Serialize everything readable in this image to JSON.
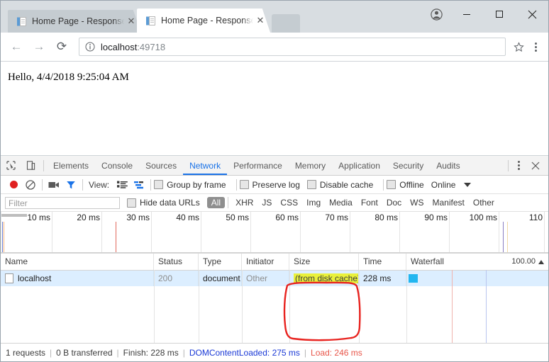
{
  "window": {
    "controls": {
      "avatar": "profile-avatar",
      "minimize": "–",
      "maximize": "☐",
      "close": "✕"
    }
  },
  "tabs": [
    {
      "title": "Home Page - ResponseC",
      "close": "✕",
      "active": false
    },
    {
      "title": "Home Page - ResponseC",
      "close": "✕",
      "active": true
    }
  ],
  "toolbar": {
    "back": "←",
    "forward": "→",
    "reload": "⟳",
    "url_host": "localhost",
    "url_port": ":49718",
    "bookmark": "☆"
  },
  "page": {
    "text": "Hello, 4/4/2018 9:25:04 AM"
  },
  "devtools": {
    "panels": [
      {
        "label": "Elements",
        "active": false
      },
      {
        "label": "Console",
        "active": false
      },
      {
        "label": "Sources",
        "active": false
      },
      {
        "label": "Network",
        "active": true
      },
      {
        "label": "Performance",
        "active": false
      },
      {
        "label": "Memory",
        "active": false
      },
      {
        "label": "Application",
        "active": false
      },
      {
        "label": "Security",
        "active": false
      },
      {
        "label": "Audits",
        "active": false
      }
    ],
    "close": "✕",
    "network_toolbar": {
      "record_title": "record",
      "clear_title": "clear",
      "capture_screenshots_title": "camera",
      "filter_title": "filter",
      "view_label": "View:",
      "checkboxes": [
        {
          "label": "Group by frame",
          "checked": false
        },
        {
          "label": "Preserve log",
          "checked": false
        },
        {
          "label": "Disable cache",
          "checked": false
        },
        {
          "label": "Offline",
          "checked": false
        }
      ],
      "throttling": "Online"
    },
    "filter_bar": {
      "placeholder": "Filter",
      "value": "",
      "hide_data_urls": "Hide data URLs",
      "types": [
        {
          "label": "All",
          "active": true
        },
        {
          "label": "XHR",
          "active": false
        },
        {
          "label": "JS",
          "active": false
        },
        {
          "label": "CSS",
          "active": false
        },
        {
          "label": "Img",
          "active": false
        },
        {
          "label": "Media",
          "active": false
        },
        {
          "label": "Font",
          "active": false
        },
        {
          "label": "Doc",
          "active": false
        },
        {
          "label": "WS",
          "active": false
        },
        {
          "label": "Manifest",
          "active": false
        },
        {
          "label": "Other",
          "active": false
        }
      ]
    },
    "overview": {
      "ticks": [
        "10 ms",
        "20 ms",
        "30 ms",
        "40 ms",
        "50 ms",
        "60 ms",
        "70 ms",
        "80 ms",
        "90 ms",
        "100 ms",
        "110"
      ]
    },
    "table": {
      "columns": [
        "Name",
        "Status",
        "Type",
        "Initiator",
        "Size",
        "Time",
        "Waterfall"
      ],
      "waterfall_scale": "100.00",
      "rows": [
        {
          "name": "localhost",
          "status": "200",
          "type": "document",
          "initiator": "Other",
          "size": "(from disk cache)",
          "time": "228 ms"
        }
      ]
    },
    "statusbar": {
      "requests": "1 requests",
      "transferred": "0 B transferred",
      "finish": "Finish: 228 ms",
      "dom_content_loaded": "DOMContentLoaded: 275 ms",
      "load": "Load: 246 ms",
      "divider": "|"
    }
  },
  "colors": {
    "accent": "#1a73e8",
    "record": "#e02020",
    "highlight": "#eaf13b",
    "annotation": "#e8231f",
    "waterfall_bar": "#22b6f0",
    "dcl": "#1a39d6",
    "load": "#e8564a"
  }
}
